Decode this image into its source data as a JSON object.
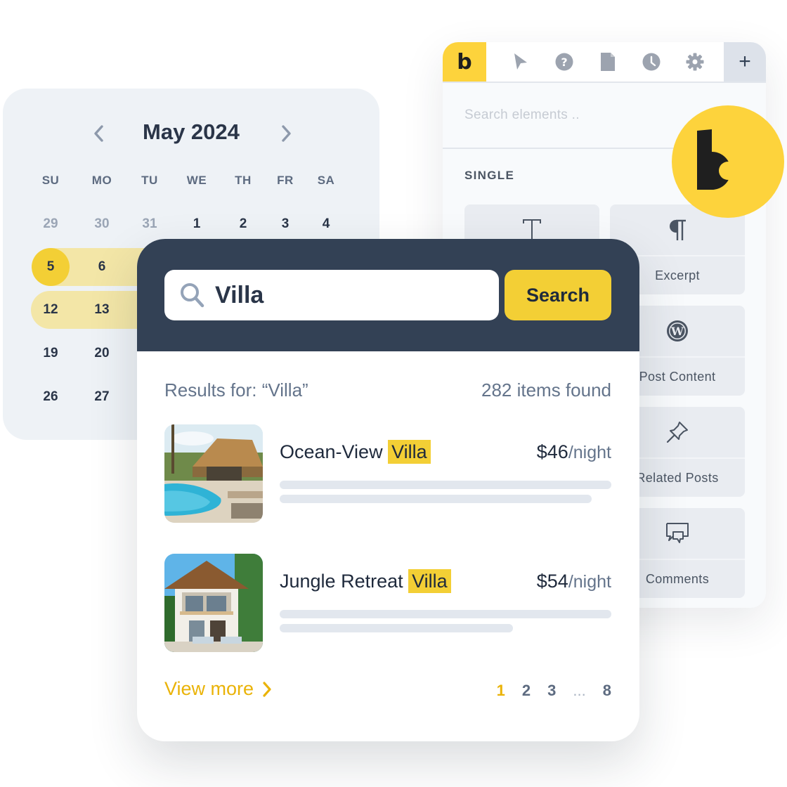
{
  "builder": {
    "logo_letter": "b",
    "toolbar_icons": [
      "cursor-icon",
      "help-icon",
      "page-icon",
      "history-icon",
      "settings-icon"
    ],
    "add_label": "+",
    "search_placeholder": "Search elements ..",
    "section_title": "SINGLE",
    "elements": [
      {
        "label": "",
        "icon": "text-icon"
      },
      {
        "label": "Excerpt",
        "icon": "paragraph-icon"
      },
      {
        "label": "Post Content",
        "icon": "wordpress-icon"
      },
      {
        "label": "Related Posts",
        "icon": "pin-icon"
      },
      {
        "label": "Comments",
        "icon": "comments-icon"
      }
    ],
    "brand_badge_letter": "b"
  },
  "calendar": {
    "title": "May 2024",
    "weekdays": [
      "SU",
      "MO",
      "TU",
      "WE",
      "TH",
      "FR",
      "SA"
    ],
    "rows": [
      [
        {
          "d": "29",
          "muted": true
        },
        {
          "d": "30",
          "muted": true
        },
        {
          "d": "31",
          "muted": true
        },
        {
          "d": "1"
        },
        {
          "d": "2"
        },
        {
          "d": "3"
        },
        {
          "d": "4"
        }
      ],
      [
        {
          "d": "5",
          "selected": true
        },
        {
          "d": "6"
        }
      ],
      [
        {
          "d": "12"
        },
        {
          "d": "13"
        }
      ],
      [
        {
          "d": "19"
        },
        {
          "d": "20"
        }
      ],
      [
        {
          "d": "26"
        },
        {
          "d": "27"
        }
      ]
    ]
  },
  "search": {
    "query": "Villa",
    "button_label": "Search",
    "results_label": "Results for: “Villa”",
    "count_label": "282 items found",
    "results": [
      {
        "title": "Ocean-View",
        "highlight": "Villa",
        "price": "$46",
        "unit": "/night"
      },
      {
        "title": "Jungle Retreat",
        "highlight": "Villa",
        "price": "$54",
        "unit": "/night"
      }
    ],
    "view_more": "View more",
    "pages": [
      "1",
      "2",
      "3",
      "...",
      "8"
    ],
    "current_page": "1"
  },
  "colors": {
    "accent": "#f3cf35",
    "brand_yellow": "#fdd33c",
    "header_dark": "#334155",
    "link_yellow": "#eab308"
  }
}
